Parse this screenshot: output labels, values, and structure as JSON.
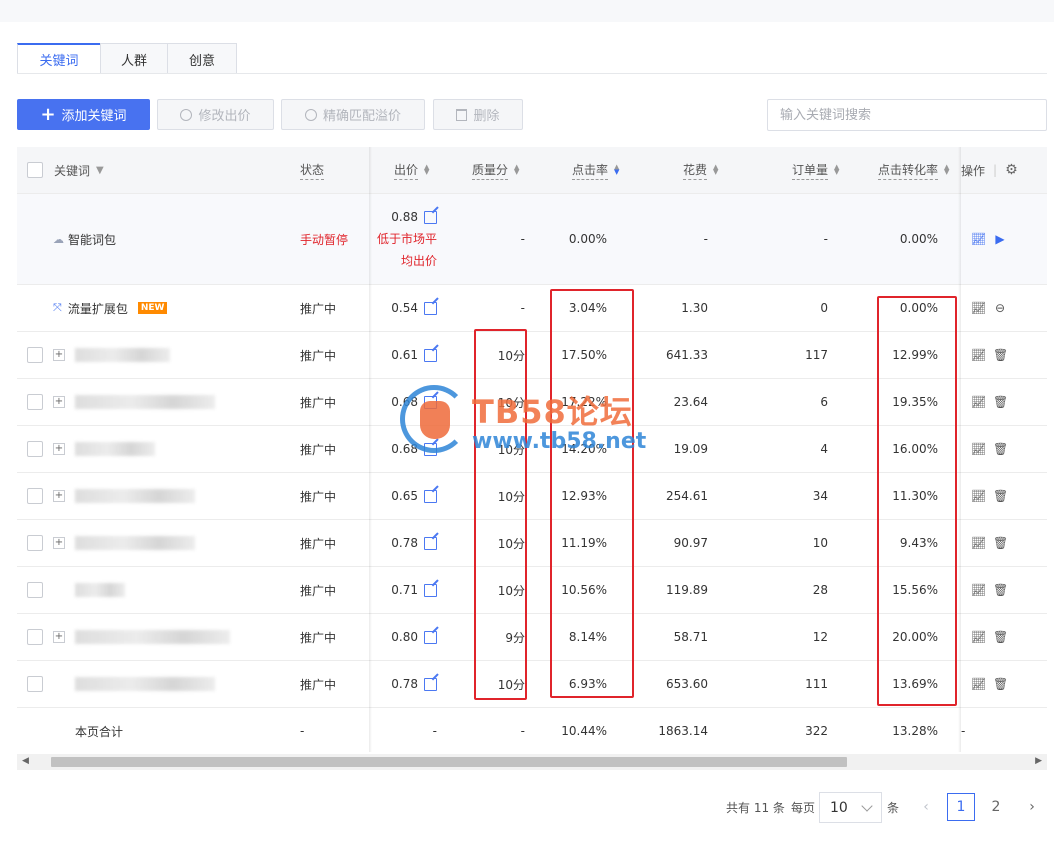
{
  "tabs": [
    {
      "label": "关键词",
      "active": true
    },
    {
      "label": "人群",
      "active": false
    },
    {
      "label": "创意",
      "active": false
    }
  ],
  "toolbar": {
    "add_label": "添加关键词",
    "modify_bid_label": "修改出价",
    "exact_premium_label": "精确匹配溢价",
    "delete_label": "删除",
    "search_placeholder": "输入关键词搜索"
  },
  "table": {
    "headers": {
      "keyword": "关键词",
      "status": "状态",
      "bid": "出价",
      "quality": "质量分",
      "ctr": "点击率",
      "cost": "花费",
      "orders": "订单量",
      "cvr": "点击转化率",
      "ops": "操作"
    },
    "special_rows": [
      {
        "name": "智能词包",
        "status": "手动暂停",
        "bid": "0.88",
        "bid_note": "低于市场平均出价",
        "quality": "-",
        "ctr": "0.00%",
        "cost": "-",
        "orders": "-",
        "cvr": "0.00%"
      },
      {
        "name": "流量扩展包",
        "badge": "NEW",
        "status": "推广中",
        "bid": "0.54",
        "quality": "-",
        "ctr": "3.04%",
        "cost": "1.30",
        "orders": "0",
        "cvr": "0.00%"
      }
    ],
    "rows": [
      {
        "status": "推广中",
        "bid": "0.61",
        "quality": "10分",
        "ctr": "17.50%",
        "cost": "641.33",
        "orders": "117",
        "cvr": "12.99%"
      },
      {
        "status": "推广中",
        "bid": "0.68",
        "quality": "10分",
        "ctr": "17.22%",
        "cost": "23.64",
        "orders": "6",
        "cvr": "19.35%"
      },
      {
        "status": "推广中",
        "bid": "0.68",
        "quality": "10分",
        "ctr": "14.20%",
        "cost": "19.09",
        "orders": "4",
        "cvr": "16.00%"
      },
      {
        "status": "推广中",
        "bid": "0.65",
        "quality": "10分",
        "ctr": "12.93%",
        "cost": "254.61",
        "orders": "34",
        "cvr": "11.30%"
      },
      {
        "status": "推广中",
        "bid": "0.78",
        "quality": "10分",
        "ctr": "11.19%",
        "cost": "90.97",
        "orders": "10",
        "cvr": "9.43%"
      },
      {
        "status": "推广中",
        "bid": "0.71",
        "quality": "10分",
        "ctr": "10.56%",
        "cost": "119.89",
        "orders": "28",
        "cvr": "15.56%"
      },
      {
        "status": "推广中",
        "bid": "0.80",
        "quality": "9分",
        "ctr": "8.14%",
        "cost": "58.71",
        "orders": "12",
        "cvr": "20.00%"
      },
      {
        "status": "推广中",
        "bid": "0.78",
        "quality": "10分",
        "ctr": "6.93%",
        "cost": "653.60",
        "orders": "111",
        "cvr": "13.69%"
      }
    ],
    "totals": {
      "label": "本页合计",
      "status": "-",
      "bid": "-",
      "quality": "-",
      "ctr": "10.44%",
      "cost": "1863.14",
      "orders": "322",
      "cvr": "13.28%",
      "ops": "-"
    }
  },
  "pagination": {
    "total_text": "共有 11 条",
    "per_page_label": "每页",
    "per_page_value": "10",
    "unit": "条",
    "pages": [
      "1",
      "2"
    ],
    "current": "1"
  },
  "watermark": {
    "title": "TB58论坛",
    "url": "www.tb58.net"
  },
  "colors": {
    "accent": "#4872f0",
    "danger": "#e0242b",
    "badge": "#ff8a00"
  }
}
